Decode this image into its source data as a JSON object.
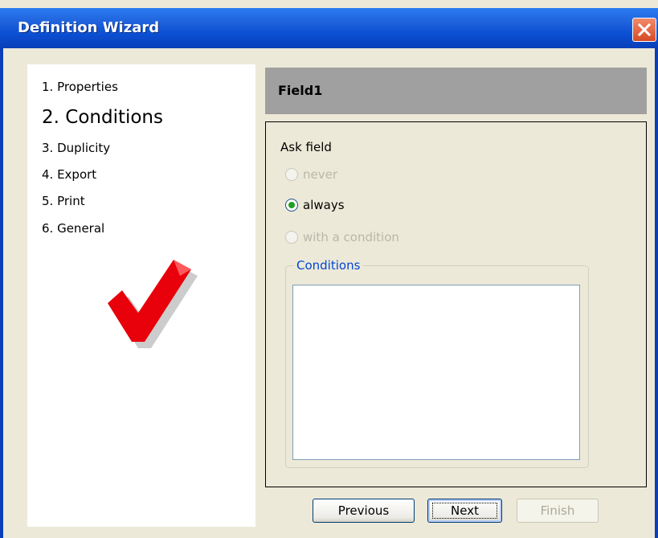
{
  "window": {
    "title": "Definition Wizard",
    "close_icon": "close-icon"
  },
  "steps": [
    {
      "label": "1. Properties",
      "active": false
    },
    {
      "label": "2. Conditions",
      "active": true
    },
    {
      "label": "3. Duplicity",
      "active": false
    },
    {
      "label": "4. Export",
      "active": false
    },
    {
      "label": "5. Print",
      "active": false
    },
    {
      "label": "6. General",
      "active": false
    }
  ],
  "step_indicator_icon": "red-checkmark-icon",
  "header": {
    "field_name": "Field1"
  },
  "ask_field": {
    "label": "Ask field",
    "options": [
      {
        "label": "never",
        "enabled": false,
        "selected": false
      },
      {
        "label": "always",
        "enabled": true,
        "selected": true
      },
      {
        "label": "with a condition",
        "enabled": false,
        "selected": false
      }
    ]
  },
  "conditions": {
    "label": "Conditions",
    "items": []
  },
  "buttons": {
    "previous": "Previous",
    "next": "Next",
    "finish": "Finish"
  },
  "colors": {
    "title_bar": "#0a4fd3",
    "close_button": "#d74a25",
    "header_bar": "#a0a0a0",
    "radio_selected": "#21a121",
    "group_label": "#0046d5",
    "checkmark": "#e8000a"
  }
}
